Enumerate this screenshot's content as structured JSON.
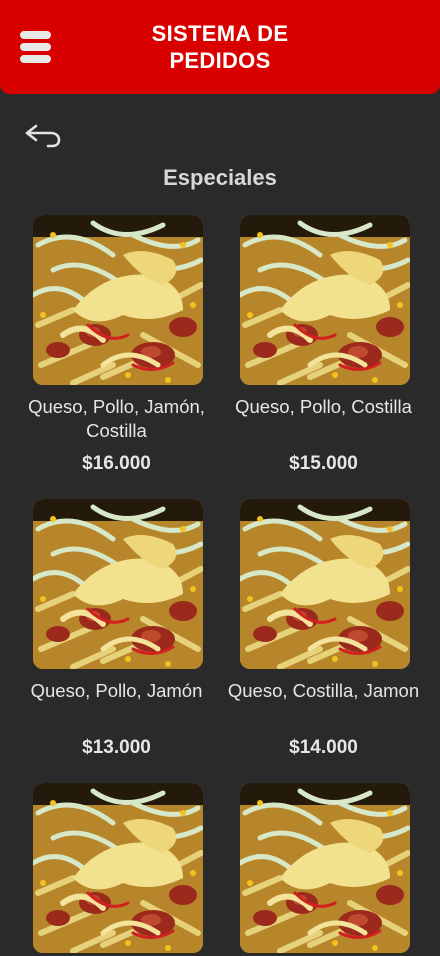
{
  "header": {
    "title": "SISTEMA DE PEDIDOS",
    "menu_icon": "hamburger-menu-icon",
    "background_color": "#d90000"
  },
  "back_icon": "back-arrow-icon",
  "section": {
    "title": "Especiales"
  },
  "products": [
    {
      "name": "Queso, Pollo, Jamón, Costilla",
      "price": "$16.000"
    },
    {
      "name": "Queso, Pollo, Costilla",
      "price": "$15.000"
    },
    {
      "name": "Queso, Pollo, Jamón",
      "price": "$13.000"
    },
    {
      "name": "Queso, Costilla, Jamon",
      "price": "$14.000"
    },
    {
      "name": "",
      "price": ""
    },
    {
      "name": "",
      "price": ""
    }
  ]
}
